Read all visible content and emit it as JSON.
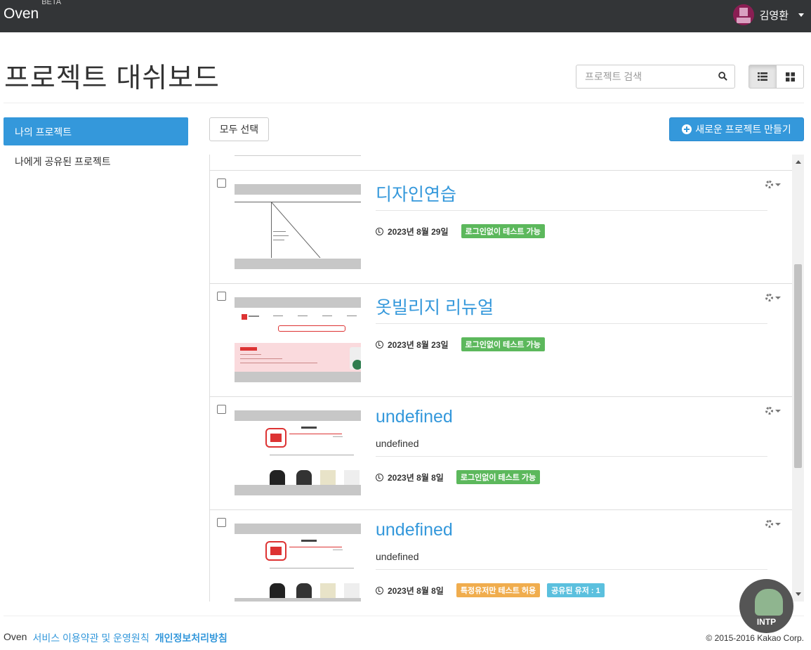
{
  "navbar": {
    "brand": "Oven",
    "beta": "BETA",
    "user_name": "김영환"
  },
  "page_title": "프로젝트 대쉬보드",
  "search": {
    "placeholder": "프로젝트 검색"
  },
  "sidebar": {
    "items": [
      {
        "label": "나의 프로젝트",
        "active": true
      },
      {
        "label": "나에게 공유된 프로젝트",
        "active": false
      }
    ]
  },
  "toolbar": {
    "select_all": "모두 선택",
    "new_project": "새로운 프로젝트 만들기"
  },
  "projects": [
    {
      "title": "디자인연습",
      "description": "",
      "date": "2023년 8월 29일",
      "badges": [
        "로그인없이 테스트 가능"
      ]
    },
    {
      "title": "옷빌리지 리뉴얼",
      "description": "",
      "date": "2023년 8월 23일",
      "badges": [
        "로그인없이 테스트 가능"
      ]
    },
    {
      "title": "undefined",
      "description": "undefined",
      "date": "2023년 8월 8일",
      "badges": [
        "로그인없이 테스트 가능"
      ]
    },
    {
      "title": "undefined",
      "description": "undefined",
      "date": "2023년 8월 8일",
      "badges": [
        "특정유저만 테스트 허용",
        "공유된 유저 : 1"
      ]
    }
  ],
  "footer": {
    "brand": "Oven",
    "terms": "서비스 이용약관 및 운영원칙",
    "privacy": "개인정보처리방침",
    "copyright": "© 2015-2016 Kakao Corp."
  },
  "overlay": {
    "label": "INTP"
  },
  "colors": {
    "navbar": "#333537",
    "primary": "#3498db",
    "badge_green": "#5cb85c",
    "badge_orange": "#f0ad4e",
    "badge_blue": "#5bc0de"
  }
}
